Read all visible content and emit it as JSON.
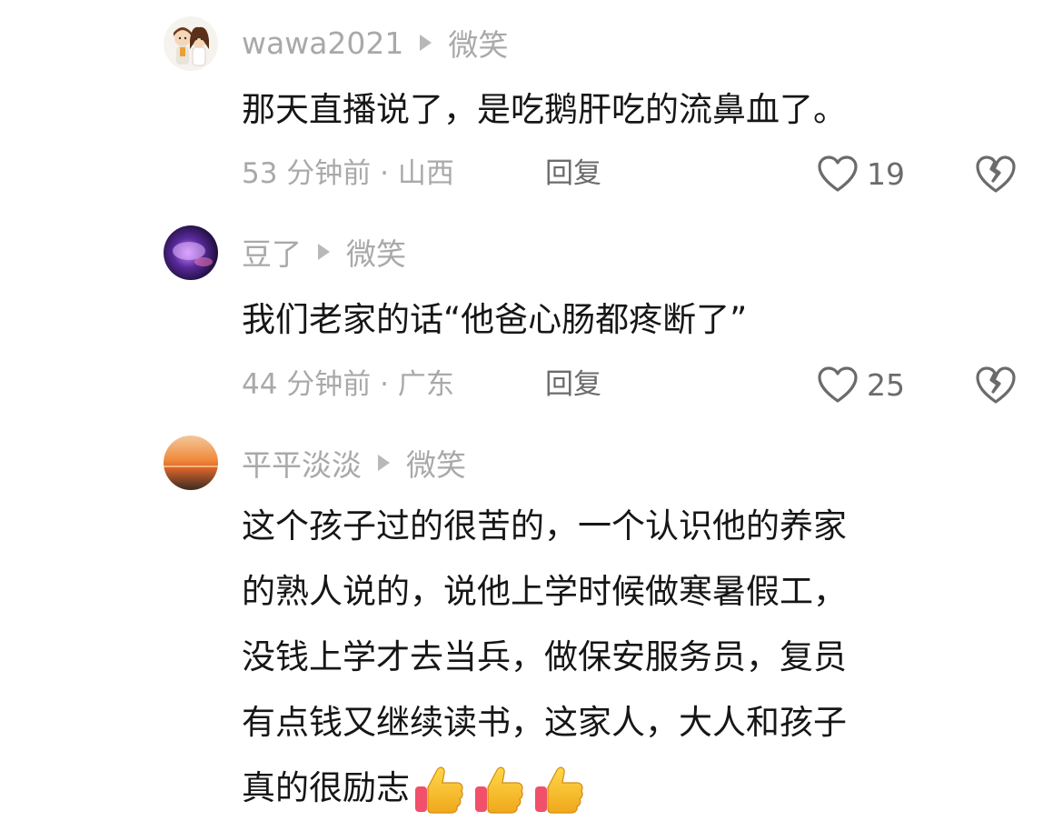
{
  "comments": [
    {
      "username": "wawa2021",
      "reaction": "微笑",
      "text": "那天直播说了，是吃鹅肝吃的流鼻血了。",
      "time_location": "53 分钟前 · 山西",
      "reply_label": "回复",
      "likes": "19",
      "avatar_icon": "couple-cartoon-avatar"
    },
    {
      "username": "豆了",
      "reaction": "微笑",
      "text": "我们老家的话“他爸心肠都疼断了”",
      "time_location": "44 分钟前 · 广东",
      "reply_label": "回复",
      "likes": "25",
      "avatar_icon": "purple-galaxy-avatar"
    },
    {
      "username": "平平淡淡",
      "reaction": "微笑",
      "text": "这个孩子过的很苦的，一个认识他的养家\n的熟人说的，说他上学时候做寒暑假工，\n没钱上学才去当兵，做保安服务员，复员\n有点钱又继续读书，这家人，大人和孩子\n真的很励志",
      "emojis": [
        "thumbs-up-icon",
        "thumbs-up-icon",
        "thumbs-up-icon"
      ],
      "avatar_icon": "sunset-avatar"
    }
  ],
  "colors": {
    "muted": "#a9a9ab",
    "reply": "#6b6b6d",
    "text": "#161616"
  }
}
